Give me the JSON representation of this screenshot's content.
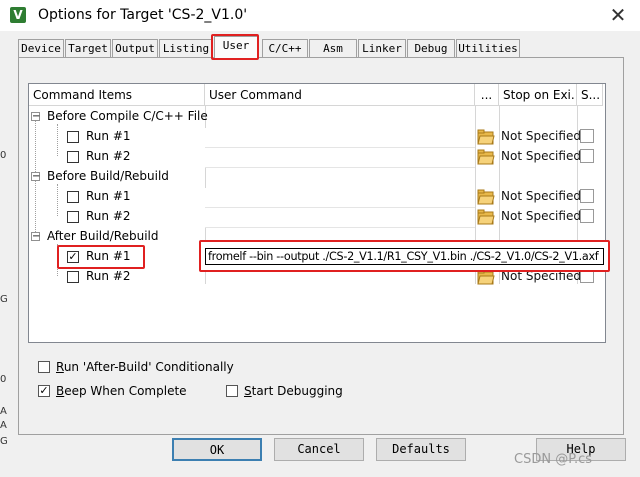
{
  "window": {
    "title": "Options for Target 'CS-2_V1.0'",
    "close_glyph": "✕",
    "app_icon_glyph": "V"
  },
  "background_fragments": [
    "0",
    "G",
    "0",
    "A",
    "A",
    "G"
  ],
  "tabs": [
    {
      "label": "Device"
    },
    {
      "label": "Target"
    },
    {
      "label": "Output"
    },
    {
      "label": "Listing"
    },
    {
      "label": "User",
      "active": true
    },
    {
      "label": "C/C++"
    },
    {
      "label": "Asm"
    },
    {
      "label": "Linker"
    },
    {
      "label": "Debug"
    },
    {
      "label": "Utilities"
    }
  ],
  "grid": {
    "headers": {
      "items": "Command Items",
      "command": "User Command",
      "browse": "...",
      "stop": "Stop on Exi...",
      "s": "S..."
    },
    "groups": [
      {
        "label": "Before Compile C/C++ File",
        "expander": "−",
        "runs": [
          {
            "label": "Run #1",
            "checked": false,
            "command": "",
            "stop": "Not Specified"
          },
          {
            "label": "Run #2",
            "checked": false,
            "command": "",
            "stop": "Not Specified"
          }
        ]
      },
      {
        "label": "Before Build/Rebuild",
        "expander": "−",
        "runs": [
          {
            "label": "Run #1",
            "checked": false,
            "command": "",
            "stop": "Not Specified"
          },
          {
            "label": "Run #2",
            "checked": false,
            "command": "",
            "stop": "Not Specified"
          }
        ]
      },
      {
        "label": "After Build/Rebuild",
        "expander": "−",
        "runs": [
          {
            "label": "Run #1",
            "checked": true,
            "command": "fromelf --bin --output ./CS-2_V1.1/R1_CSY_V1.bin ./CS-2_V1.0/CS-2_V1.axf",
            "stop": ""
          },
          {
            "label": "Run #2",
            "checked": false,
            "command": "",
            "stop": "Not Specified"
          }
        ]
      }
    ]
  },
  "options": {
    "run_after_build": {
      "mnemonic": "R",
      "rest": "un 'After-Build' Conditionally",
      "checked": false
    },
    "beep": {
      "mnemonic": "B",
      "rest": "eep When Complete",
      "checked": true
    },
    "start_debugging": {
      "mnemonic": "S",
      "rest": "tart Debugging",
      "checked": false
    }
  },
  "buttons": {
    "ok": "OK",
    "cancel": "Cancel",
    "defaults": "Defaults",
    "help": "Help"
  },
  "watermark": "CSDN @P.cs",
  "colors": {
    "highlight_red": "#e02020",
    "folder_yellow": "#e8b84a"
  }
}
